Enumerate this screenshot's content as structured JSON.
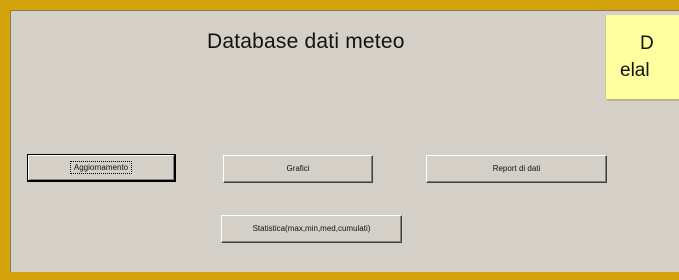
{
  "form": {
    "title": "Database dati meteo"
  },
  "note": {
    "line1": "D",
    "line2": "elal"
  },
  "buttons": {
    "aggiornamento": "Aggiornamento",
    "grafici": "Grafici",
    "report": "Report di dati",
    "statistica": "Statistica(max,min,med,cumulati)"
  },
  "colors": {
    "frame": "#d4a20a",
    "form_background": "#d4d0c8",
    "note_background": "#ffffa0"
  }
}
